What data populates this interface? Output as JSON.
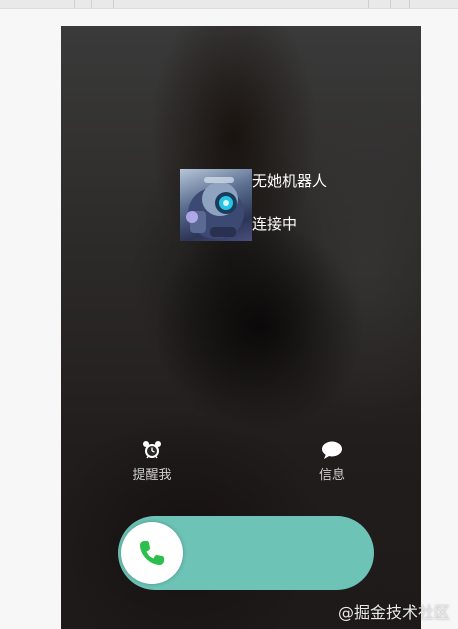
{
  "caller": {
    "name": "无她机器人",
    "status": "连接中"
  },
  "actions": {
    "remind_label": "提醒我",
    "remind_icon": "alarm-clock-icon",
    "message_label": "信息",
    "message_icon": "chat-bubble-icon"
  },
  "slider": {
    "icon": "phone-icon",
    "track_color": "#6cc3b6",
    "icon_color": "#2dbf4e"
  },
  "watermark": "@掘金技术社区"
}
